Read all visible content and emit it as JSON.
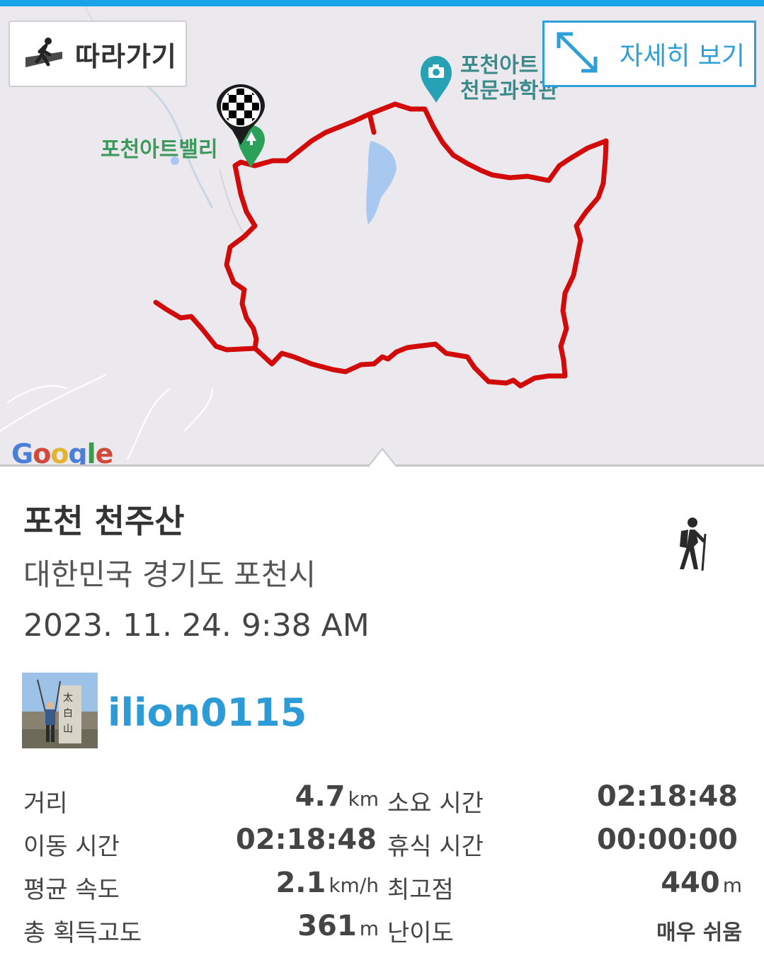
{
  "map": {
    "follow_label": "따라가기",
    "detail_label": "자세히 보기",
    "poi_label_line1": "포천아트",
    "poi_label_line2": "천문과학관",
    "park_label": "포천아트밸리",
    "attribution": "Google",
    "route_color": "#d10a0a"
  },
  "track": {
    "title": "포천 천주산",
    "location": "대한민국 경기도 포천시",
    "datetime": "2023. 11. 24. 9:38 AM",
    "activity_icon": "hiking-icon",
    "user": {
      "username": "ilion0115",
      "avatar_icon": "user-photo"
    }
  },
  "stats": {
    "distance": {
      "label": "거리",
      "value": "4.7",
      "unit": "km"
    },
    "total_time": {
      "label": "소요 시간",
      "value": "02:18:48"
    },
    "moving_time": {
      "label": "이동 시간",
      "value": "02:18:48"
    },
    "rest_time": {
      "label": "휴식 시간",
      "value": "00:00:00"
    },
    "avg_speed": {
      "label": "평균 속도",
      "value": "2.1",
      "unit": "km/h"
    },
    "max_elevation": {
      "label": "최고점",
      "value": "440",
      "unit": "m"
    },
    "total_ascent": {
      "label": "총 획득고도",
      "value": "361",
      "unit": "m"
    },
    "difficulty": {
      "label": "난이도",
      "value": "매우 쉬움"
    }
  },
  "colors": {
    "accent": "#2d9bd6",
    "topbar": "#1aa3e8"
  }
}
